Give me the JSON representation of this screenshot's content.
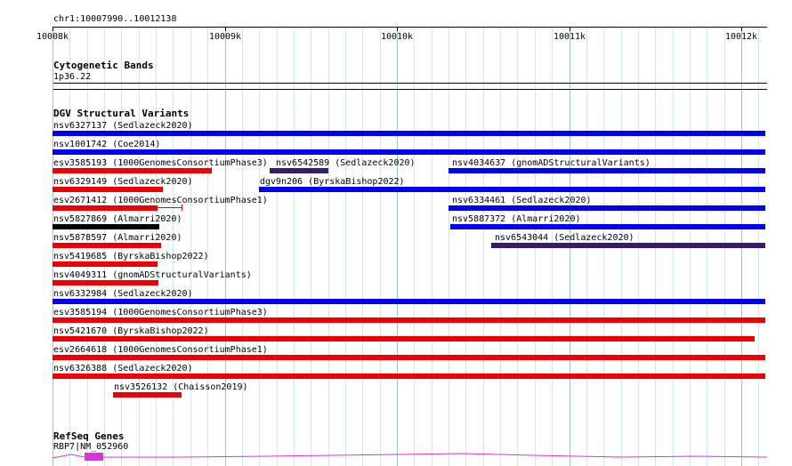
{
  "location": "chr1:10007990..10012138",
  "ruler": {
    "ticks": [
      "10008k",
      "10009k",
      "10010k",
      "10011k",
      "10012k"
    ]
  },
  "cytoband": {
    "title": "Cytogenetic Bands",
    "band": "1p36.22"
  },
  "dgv": {
    "title": "DGV Structural Variants",
    "features": [
      {
        "label": "nsv6327137 (Sedlazeck2020)",
        "color": "#0000ee",
        "start": 10007990,
        "end": 10012138
      },
      {
        "label": "nsv1001742 (Coe2014)",
        "color": "#0000ee",
        "start": 10007990,
        "end": 10012138
      },
      {
        "label": "esv3585193 (1000GenomesConsortiumPhase3)",
        "color": "#ee0000",
        "start": 10008000,
        "end": 10008920
      },
      {
        "label": "nsv6542589 (Sedlazeck2020)",
        "color": "#3a1a6e",
        "start": 10009260,
        "end": 10009600
      },
      {
        "label": "nsv4034637 (gnomADStructuralVariants)",
        "color": "#0000ee",
        "start": 10010300,
        "end": 10012138
      },
      {
        "label": "nsv6329149 (Sedlazeck2020)",
        "color": "#ee0000",
        "start": 10008000,
        "end": 10008640
      },
      {
        "label": "dgv9n206 (ByrskaBishop2022)",
        "color": "#0000ee",
        "start": 10009200,
        "end": 10012138
      },
      {
        "label": "esv2671412 (1000GenomesConsortiumPhase1)",
        "color": "#ee0000",
        "start": 10008000,
        "end": 10008610
      },
      {
        "label": "nsv6334461 (Sedlazeck2020)",
        "color": "#0000ee",
        "start": 10010300,
        "end": 10012138
      },
      {
        "label": "nsv5827869 (Almarri2020)",
        "color": "#000000",
        "start": 10008000,
        "end": 10008620
      },
      {
        "label": "nsv5887372 (Almarri2020)",
        "color": "#0000ee",
        "start": 10010310,
        "end": 10012138
      },
      {
        "label": "nsv5878597 (Almarri2020)",
        "color": "#ee0000",
        "start": 10008000,
        "end": 10008630
      },
      {
        "label": "nsv6543044 (Sedlazeck2020)",
        "color": "#3a1a6e",
        "start": 10010550,
        "end": 10012138
      },
      {
        "label": "nsv5419685 (ByrskaBishop2022)",
        "color": "#ee0000",
        "start": 10008000,
        "end": 10008610
      },
      {
        "label": "nsv4049311 (gnomADStructuralVariants)",
        "color": "#ee0000",
        "start": 10008000,
        "end": 10008615
      },
      {
        "label": "nsv6332984 (Sedlazeck2020)",
        "color": "#0000ee",
        "start": 10007990,
        "end": 10012138
      },
      {
        "label": "esv3585194 (1000GenomesConsortiumPhase3)",
        "color": "#ee0000",
        "start": 10007990,
        "end": 10012138
      },
      {
        "label": "nsv5421670 (ByrskaBishop2022)",
        "color": "#ee0000",
        "start": 10007990,
        "end": 10012080
      },
      {
        "label": "esv2664618 (1000GenomesConsortiumPhase1)",
        "color": "#ee0000",
        "start": 10007990,
        "end": 10012138
      },
      {
        "label": "nsv6326388 (Sedlazeck2020)",
        "color": "#ee0000",
        "start": 10007990,
        "end": 10012138
      },
      {
        "label": "nsv3526132 (Chaisson2019)",
        "color": "#ee0000",
        "start": 10008350,
        "end": 10008750
      }
    ]
  },
  "refseq": {
    "title": "RefSeq Genes",
    "gene": "RBP7|NM_052960",
    "color": "#e030e0"
  }
}
